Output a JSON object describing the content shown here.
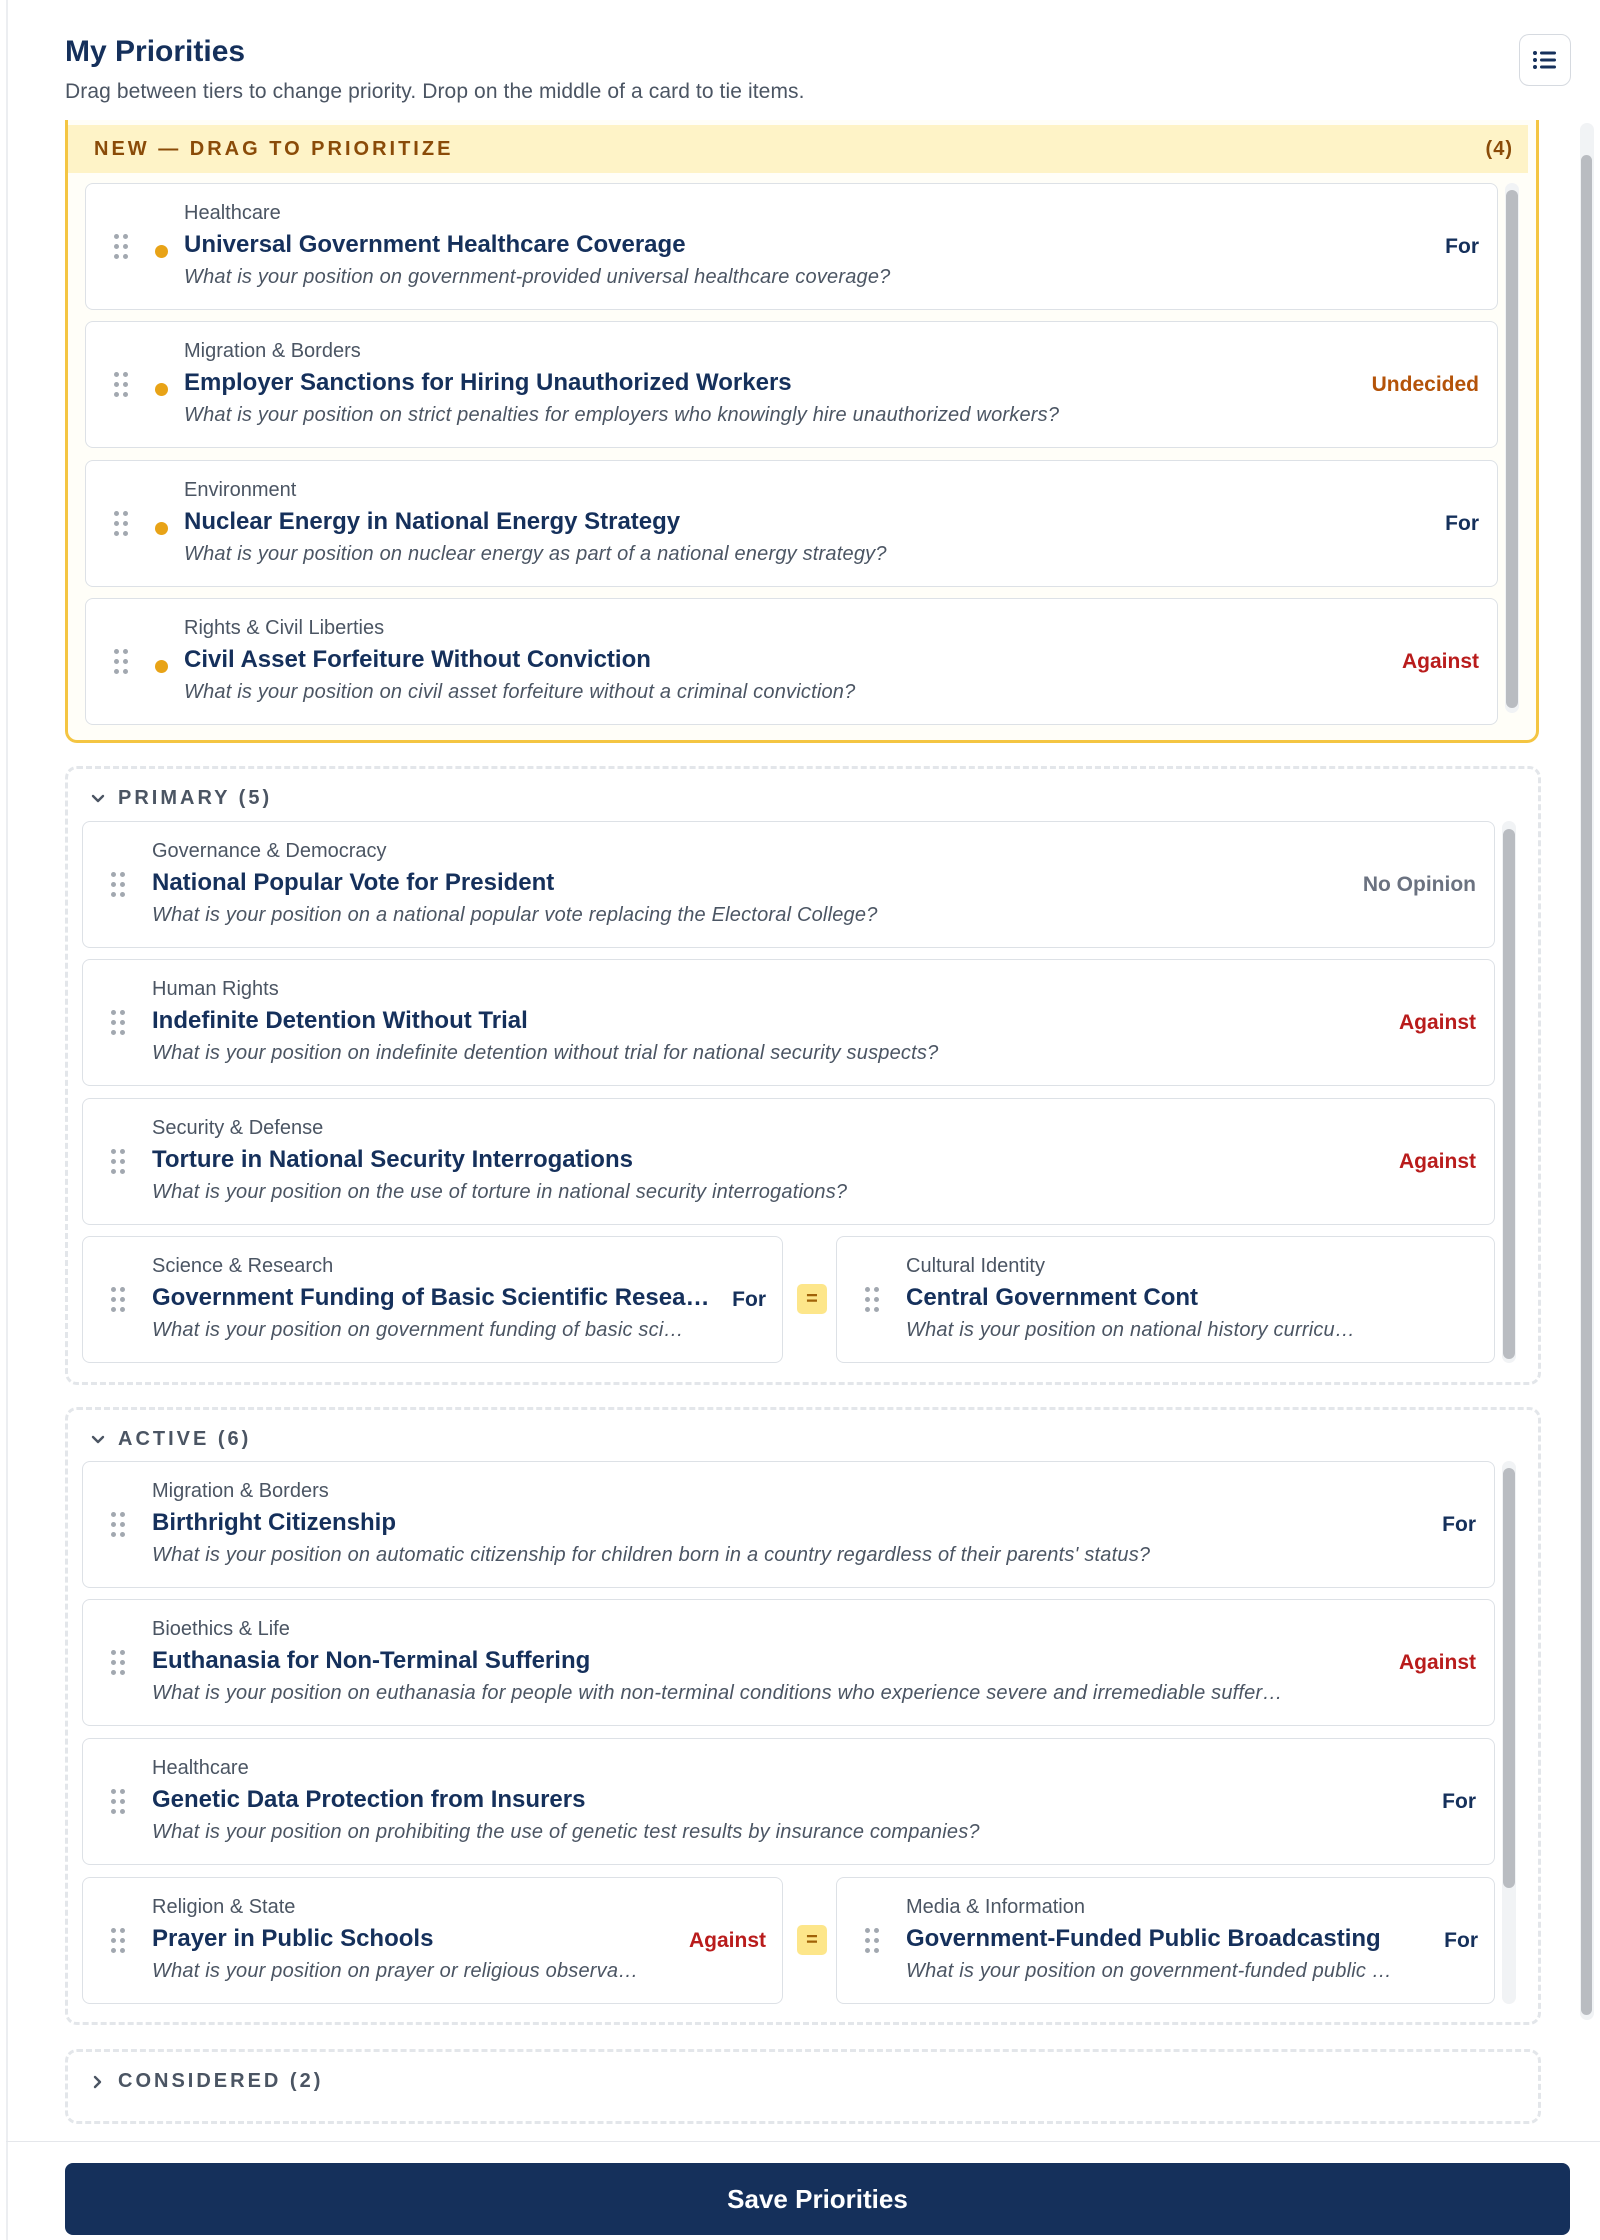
{
  "header": {
    "title": "My Priorities",
    "subtitle": "Drag between tiers to change priority. Drop on the middle of a card to tie items.",
    "menu_icon": "list-settings-icon"
  },
  "new_section": {
    "label": "NEW — DRAG TO PRIORITIZE",
    "count": "(4)",
    "items": [
      {
        "category": "Healthcare",
        "title": "Universal Government Healthcare Coverage",
        "question": "What is your position on government-provided universal healthcare coverage?",
        "stance": "For"
      },
      {
        "category": "Migration & Borders",
        "title": "Employer Sanctions for Hiring Unauthorized Workers",
        "question": "What is your position on strict penalties for employers who knowingly hire unauthorized workers?",
        "stance": "Undecided"
      },
      {
        "category": "Environment",
        "title": "Nuclear Energy in National Energy Strategy",
        "question": "What is your position on nuclear energy as part of a national energy strategy?",
        "stance": "For"
      },
      {
        "category": "Rights & Civil Liberties",
        "title": "Civil Asset Forfeiture Without Conviction",
        "question": "What is your position on civil asset forfeiture without a criminal conviction?",
        "stance": "Against"
      }
    ]
  },
  "primary": {
    "label": "PRIMARY (5)",
    "items": [
      {
        "category": "Governance & Democracy",
        "title": "National Popular Vote for President",
        "question": "What is your position on a national popular vote replacing the Electoral College?",
        "stance": "No Opinion"
      },
      {
        "category": "Human Rights",
        "title": "Indefinite Detention Without Trial",
        "question": "What is your position on indefinite detention without trial for national security suspects?",
        "stance": "Against"
      },
      {
        "category": "Security & Defense",
        "title": "Torture in National Security Interrogations",
        "question": "What is your position on the use of torture in national security interrogations?",
        "stance": "Against"
      }
    ],
    "tied": [
      {
        "category": "Science & Research",
        "title": "Government Funding of Basic Scientific Resea…",
        "question": "What is your position on government funding of basic sci…",
        "stance": "For"
      },
      {
        "category": "Cultural Identity",
        "title": "Central Government Cont",
        "question": "What is your position on national history curricu…",
        "stance": ""
      }
    ],
    "tie_symbol": "="
  },
  "active": {
    "label": "ACTIVE (6)",
    "items": [
      {
        "category": "Migration & Borders",
        "title": "Birthright Citizenship",
        "question": "What is your position on automatic citizenship for children born in a country regardless of their parents' status?",
        "stance": "For"
      },
      {
        "category": "Bioethics & Life",
        "title": "Euthanasia for Non-Terminal Suffering",
        "question": "What is your position on euthanasia for people with non-terminal conditions who experience severe and irremediable suffering?",
        "stance": "Against"
      },
      {
        "category": "Healthcare",
        "title": "Genetic Data Protection from Insurers",
        "question": "What is your position on prohibiting the use of genetic test results by insurance companies?",
        "stance": "For"
      }
    ],
    "tied": [
      {
        "category": "Religion & State",
        "title": "Prayer in Public Schools",
        "question": "What is your position on prayer or religious observa…",
        "stance": "Against"
      },
      {
        "category": "Media & Information",
        "title": "Government-Funded Public Broadcasting",
        "question": "What is your position on government-funded public …",
        "stance": "For"
      }
    ],
    "tie_symbol": "="
  },
  "considered": {
    "label": "CONSIDERED (2)"
  },
  "save_label": "Save Priorities",
  "colors": {
    "navy": "#15305b",
    "against": "#b91c1c",
    "undecided": "#b45309",
    "new_accent": "#f4c542",
    "new_dot": "#e8a317"
  }
}
